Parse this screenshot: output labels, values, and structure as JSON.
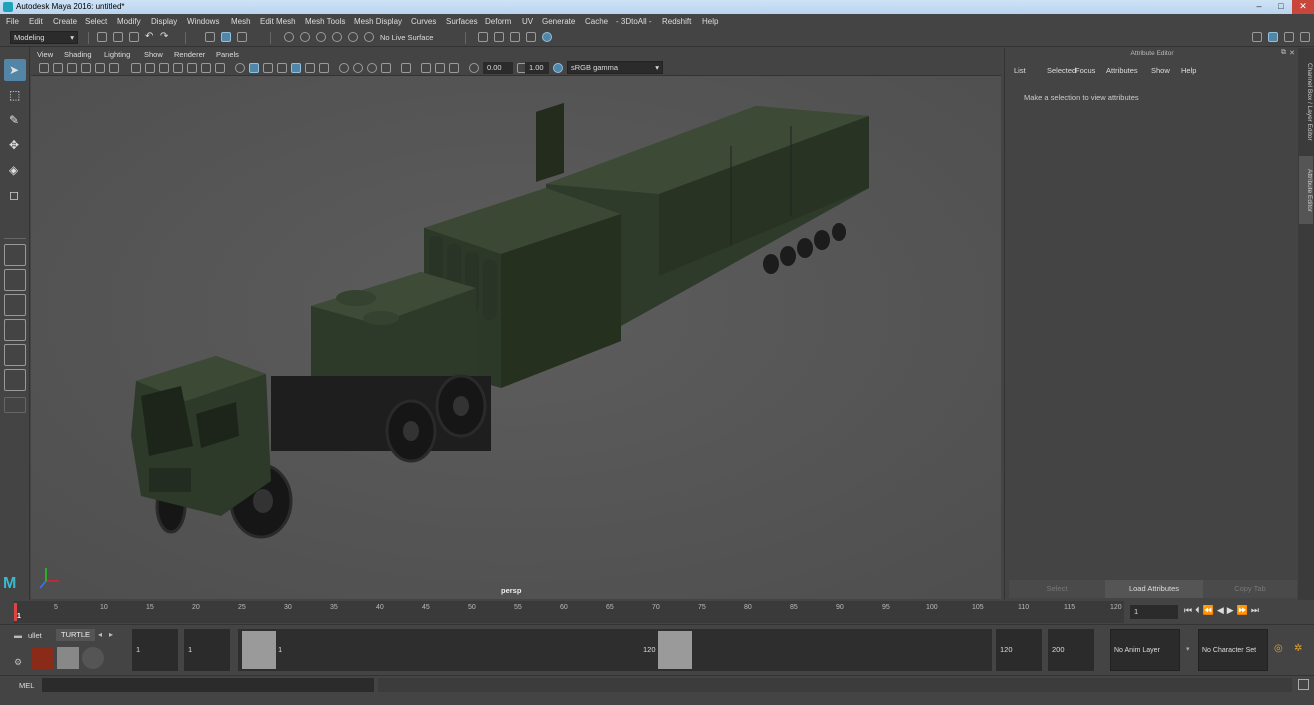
{
  "app": {
    "title": "Autodesk Maya 2016: untitled*"
  },
  "menubar": [
    "File",
    "Edit",
    "Create",
    "Select",
    "Modify",
    "Display",
    "Windows",
    "Mesh",
    "Edit Mesh",
    "Mesh Tools",
    "Mesh Display",
    "Curves",
    "Surfaces",
    "Deform",
    "UV",
    "Generate",
    "Cache",
    "- 3DtoAll -",
    "Redshift",
    "Help"
  ],
  "shelf": {
    "mode": "Modeling",
    "live_surface": "No Live Surface"
  },
  "viewport": {
    "menus": [
      "View",
      "Shading",
      "Lighting",
      "Show",
      "Renderer",
      "Panels"
    ],
    "exposure": "0.00",
    "gamma": "1.00",
    "color_space": "sRGB gamma",
    "camera_label": "persp"
  },
  "attribute_editor": {
    "header": "Attribute Editor",
    "menus": [
      "List",
      "Selected",
      "Focus",
      "Attributes",
      "Show",
      "Help"
    ],
    "message": "Make a selection to view attributes",
    "buttons": [
      "Select",
      "Load Attributes",
      "Copy Tab"
    ],
    "side_tabs": [
      "Channel Box / Layer Editor",
      "Attribute Editor"
    ]
  },
  "timeline": {
    "ticks": [
      "5",
      "10",
      "15",
      "20",
      "25",
      "30",
      "35",
      "40",
      "45",
      "50",
      "55",
      "60",
      "65",
      "70",
      "75",
      "80",
      "85",
      "90",
      "95",
      "100",
      "105",
      "110",
      "115",
      "120"
    ],
    "start_marker": "1",
    "current_frame": "1"
  },
  "range": {
    "shelf_tabs": [
      "ullet",
      "TURTLE"
    ],
    "start": "1",
    "inner_start": "1",
    "slider_start": "1",
    "slider_end": "120",
    "end": "120",
    "outer_end": "200",
    "anim_layer": "No Anim Layer",
    "char_set": "No Character Set"
  },
  "cmd": {
    "label": "MEL"
  },
  "colors": {
    "selected_tool": "#5285a6",
    "viewport_bg": "#565656",
    "vehicle": "#2f3d2b"
  }
}
